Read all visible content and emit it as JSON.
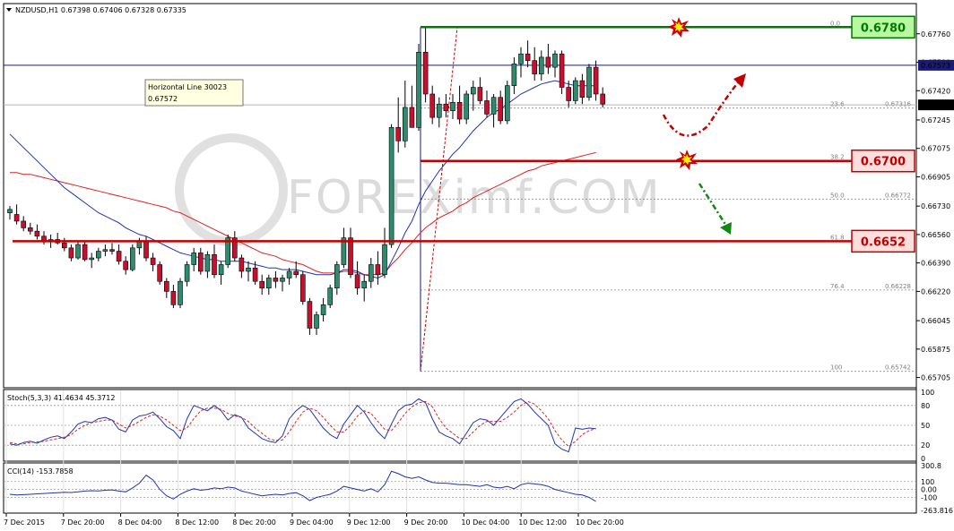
{
  "chart_data": {
    "type": "candlestick",
    "symbol_header": "NZDUSD,H1  0.67398 0.67406 0.67328 0.67335",
    "ylim": [
      0.6566,
      0.6793
    ],
    "y_ticks": [
      "0.67760",
      "0.67590",
      "0.67420",
      "0.67245",
      "0.67075",
      "0.66905",
      "0.66730",
      "0.66560",
      "0.66390",
      "0.66220",
      "0.66045",
      "0.65875",
      "0.65705"
    ],
    "x_ticks": [
      "7 Dec 2015",
      "7 Dec 20:00",
      "8 Dec 04:00",
      "8 Dec 12:00",
      "8 Dec 20:00",
      "9 Dec 04:00",
      "9 Dec 12:00",
      "9 Dec 20:00",
      "10 Dec 04:00",
      "10 Dec 12:00",
      "10 Dec 20:00"
    ],
    "current_price_label": "0.67335",
    "hline_price_label": "0.67573",
    "tooltip": {
      "title": "Horizontal Line 30023",
      "value": "0.67572"
    },
    "fib_levels": [
      {
        "ratio": "0.0",
        "price": 0.678,
        "value": ""
      },
      {
        "ratio": "23.6",
        "price": 0.67316,
        "value": "0.67316"
      },
      {
        "ratio": "38.2",
        "price": 0.67,
        "value": ""
      },
      {
        "ratio": "50.0",
        "price": 0.66772,
        "value": "0.66772"
      },
      {
        "ratio": "61.8",
        "price": 0.6652,
        "value": ""
      },
      {
        "ratio": "76.4",
        "price": 0.66228,
        "value": "0.66228"
      },
      {
        "ratio": "100",
        "price": 0.65742,
        "value": "0.65742"
      }
    ],
    "levels": [
      {
        "label": "0.6780",
        "price": 0.678,
        "color": "#007a00",
        "fill": "#b9f7a0"
      },
      {
        "label": "0.6700",
        "price": 0.67,
        "color": "#c00000",
        "fill": "#ffdede"
      },
      {
        "label": "0.6652",
        "price": 0.6652,
        "color": "#c00000",
        "fill": "#ffdede"
      }
    ],
    "candles": [
      [
        0.6669,
        0.6673,
        0.6665,
        0.6671
      ],
      [
        0.6668,
        0.6674,
        0.6662,
        0.6664
      ],
      [
        0.6664,
        0.6667,
        0.6658,
        0.666
      ],
      [
        0.666,
        0.6663,
        0.6656,
        0.6658
      ],
      [
        0.6658,
        0.6662,
        0.6653,
        0.6655
      ],
      [
        0.6655,
        0.6658,
        0.665,
        0.6652
      ],
      [
        0.6652,
        0.6656,
        0.6648,
        0.6653
      ],
      [
        0.6653,
        0.6657,
        0.665,
        0.6651
      ],
      [
        0.6651,
        0.6654,
        0.6646,
        0.6648
      ],
      [
        0.6648,
        0.665,
        0.664,
        0.6642
      ],
      [
        0.6642,
        0.6652,
        0.6641,
        0.665
      ],
      [
        0.665,
        0.6652,
        0.664,
        0.6641
      ],
      [
        0.6641,
        0.6645,
        0.6636,
        0.6642
      ],
      [
        0.6642,
        0.6648,
        0.664,
        0.6646
      ],
      [
        0.6646,
        0.665,
        0.6643,
        0.6647
      ],
      [
        0.6647,
        0.6651,
        0.6644,
        0.6646
      ],
      [
        0.6646,
        0.665,
        0.6638,
        0.664
      ],
      [
        0.664,
        0.6643,
        0.6632,
        0.6635
      ],
      [
        0.6635,
        0.665,
        0.6634,
        0.6648
      ],
      [
        0.6648,
        0.6654,
        0.6644,
        0.6652
      ],
      [
        0.6652,
        0.6655,
        0.664,
        0.6642
      ],
      [
        0.6642,
        0.6645,
        0.6634,
        0.6638
      ],
      [
        0.6638,
        0.664,
        0.6626,
        0.6628
      ],
      [
        0.6628,
        0.663,
        0.6618,
        0.6622
      ],
      [
        0.6622,
        0.6626,
        0.6612,
        0.6614
      ],
      [
        0.6614,
        0.663,
        0.6612,
        0.6628
      ],
      [
        0.6628,
        0.664,
        0.6625,
        0.6638
      ],
      [
        0.6638,
        0.6648,
        0.6634,
        0.6645
      ],
      [
        0.6645,
        0.6648,
        0.6632,
        0.6634
      ],
      [
        0.6634,
        0.6646,
        0.663,
        0.6644
      ],
      [
        0.6644,
        0.665,
        0.663,
        0.6632
      ],
      [
        0.6632,
        0.664,
        0.6626,
        0.6638
      ],
      [
        0.6638,
        0.6656,
        0.6636,
        0.6654
      ],
      [
        0.6654,
        0.6658,
        0.664,
        0.6642
      ],
      [
        0.6642,
        0.6644,
        0.663,
        0.6634
      ],
      [
        0.6634,
        0.664,
        0.6628,
        0.6636
      ],
      [
        0.6636,
        0.664,
        0.6626,
        0.6628
      ],
      [
        0.6628,
        0.6632,
        0.662,
        0.6624
      ],
      [
        0.6624,
        0.6632,
        0.662,
        0.663
      ],
      [
        0.663,
        0.6634,
        0.6624,
        0.6628
      ],
      [
        0.6628,
        0.6632,
        0.6622,
        0.663
      ],
      [
        0.663,
        0.6636,
        0.6626,
        0.6634
      ],
      [
        0.6634,
        0.664,
        0.663,
        0.6632
      ],
      [
        0.6632,
        0.6634,
        0.6614,
        0.6616
      ],
      [
        0.6616,
        0.6618,
        0.6596,
        0.66
      ],
      [
        0.66,
        0.661,
        0.6596,
        0.6608
      ],
      [
        0.6608,
        0.6618,
        0.6604,
        0.6614
      ],
      [
        0.6614,
        0.6626,
        0.6612,
        0.6624
      ],
      [
        0.6624,
        0.664,
        0.662,
        0.6638
      ],
      [
        0.6638,
        0.666,
        0.6636,
        0.6654
      ],
      [
        0.6654,
        0.666,
        0.663,
        0.6632
      ],
      [
        0.6632,
        0.664,
        0.662,
        0.6624
      ],
      [
        0.6624,
        0.6632,
        0.6616,
        0.6628
      ],
      [
        0.6628,
        0.6642,
        0.6624,
        0.6638
      ],
      [
        0.6638,
        0.6646,
        0.6626,
        0.6632
      ],
      [
        0.6632,
        0.666,
        0.663,
        0.665
      ],
      [
        0.665,
        0.6722,
        0.6648,
        0.672
      ],
      [
        0.672,
        0.6738,
        0.6705,
        0.6712
      ],
      [
        0.6712,
        0.6748,
        0.6708,
        0.6732
      ],
      [
        0.6732,
        0.6745,
        0.672,
        0.672
      ],
      [
        0.672,
        0.677,
        0.6718,
        0.6765
      ],
      [
        0.6765,
        0.678,
        0.6735,
        0.674
      ],
      [
        0.674,
        0.6745,
        0.6722,
        0.6726
      ],
      [
        0.6726,
        0.6738,
        0.672,
        0.6734
      ],
      [
        0.6734,
        0.674,
        0.6726,
        0.673
      ],
      [
        0.673,
        0.674,
        0.6725,
        0.6735
      ],
      [
        0.6735,
        0.6745,
        0.6722,
        0.6725
      ],
      [
        0.6725,
        0.6742,
        0.6722,
        0.674
      ],
      [
        0.674,
        0.6748,
        0.673,
        0.6744
      ],
      [
        0.6744,
        0.675,
        0.6734,
        0.6736
      ],
      [
        0.6736,
        0.6742,
        0.6726,
        0.6728
      ],
      [
        0.6728,
        0.674,
        0.672,
        0.6738
      ],
      [
        0.6738,
        0.6742,
        0.6722,
        0.6724
      ],
      [
        0.6724,
        0.6748,
        0.6722,
        0.6745
      ],
      [
        0.6745,
        0.6762,
        0.674,
        0.6758
      ],
      [
        0.6758,
        0.6768,
        0.675,
        0.6764
      ],
      [
        0.6764,
        0.6772,
        0.6756,
        0.676
      ],
      [
        0.676,
        0.6768,
        0.6748,
        0.6752
      ],
      [
        0.6752,
        0.6766,
        0.6748,
        0.6762
      ],
      [
        0.6762,
        0.677,
        0.6752,
        0.6756
      ],
      [
        0.6756,
        0.6766,
        0.675,
        0.6764
      ],
      [
        0.6764,
        0.6766,
        0.674,
        0.6744
      ],
      [
        0.6744,
        0.6748,
        0.6732,
        0.6736
      ],
      [
        0.6736,
        0.675,
        0.6734,
        0.6748
      ],
      [
        0.6748,
        0.6752,
        0.6734,
        0.6738
      ],
      [
        0.6738,
        0.6758,
        0.6736,
        0.6756
      ],
      [
        0.6756,
        0.676,
        0.6736,
        0.674
      ],
      [
        0.674,
        0.6744,
        0.6732,
        0.6734
      ]
    ],
    "ma_blue": [
      0.6716,
      0.6712,
      0.6708,
      0.6704,
      0.67,
      0.6696,
      0.6692,
      0.6688,
      0.6684,
      0.6681,
      0.6678,
      0.6675,
      0.6672,
      0.6669,
      0.6667,
      0.6665,
      0.6663,
      0.666,
      0.6658,
      0.6656,
      0.6655,
      0.6653,
      0.6651,
      0.6649,
      0.6647,
      0.6645,
      0.6644,
      0.6643,
      0.6642,
      0.6641,
      0.6641,
      0.664,
      0.664,
      0.664,
      0.664,
      0.6639,
      0.6638,
      0.6637,
      0.6636,
      0.6636,
      0.6635,
      0.6635,
      0.6635,
      0.6634,
      0.6633,
      0.6632,
      0.6632,
      0.6632,
      0.6633,
      0.6635,
      0.6635,
      0.6634,
      0.6632,
      0.6631,
      0.663,
      0.6632,
      0.664,
      0.6648,
      0.6657,
      0.6664,
      0.6674,
      0.6682,
      0.6688,
      0.6694,
      0.6699,
      0.6704,
      0.6708,
      0.6713,
      0.6718,
      0.6722,
      0.6726,
      0.6729,
      0.6731,
      0.6734,
      0.6737,
      0.674,
      0.6742,
      0.6744,
      0.6746,
      0.6747,
      0.6748,
      0.6747,
      0.6746,
      0.6745,
      0.6745,
      0.6745,
      0.6745
    ],
    "ma_red": [
      0.6693,
      0.6693,
      0.6692,
      0.6692,
      0.6691,
      0.669,
      0.6689,
      0.6688,
      0.6687,
      0.6686,
      0.6685,
      0.6684,
      0.6683,
      0.6682,
      0.6681,
      0.668,
      0.6679,
      0.6678,
      0.6677,
      0.6676,
      0.6675,
      0.6674,
      0.6673,
      0.6672,
      0.667,
      0.6669,
      0.6667,
      0.6665,
      0.6663,
      0.6661,
      0.6659,
      0.6657,
      0.6655,
      0.6653,
      0.6651,
      0.6649,
      0.6647,
      0.6645,
      0.6644,
      0.6643,
      0.6641,
      0.664,
      0.6639,
      0.6638,
      0.6636,
      0.6634,
      0.6633,
      0.6633,
      0.6633,
      0.6634,
      0.6634,
      0.6633,
      0.6632,
      0.6632,
      0.6632,
      0.6633,
      0.6638,
      0.6642,
      0.6647,
      0.6651,
      0.6656,
      0.666,
      0.6663,
      0.6666,
      0.6668,
      0.667,
      0.6673,
      0.6675,
      0.6678,
      0.668,
      0.6682,
      0.6684,
      0.6686,
      0.6688,
      0.669,
      0.6692,
      0.6694,
      0.6695,
      0.6697,
      0.6698,
      0.6699,
      0.67,
      0.6701,
      0.6702,
      0.6703,
      0.6704,
      0.6705
    ],
    "stoch": {
      "label": "Stoch(5,3,3) 41.4634 45.3712",
      "ticks": [
        "100",
        "80",
        "50",
        "20",
        "0"
      ],
      "main": [
        22,
        20,
        24,
        26,
        23,
        28,
        32,
        34,
        30,
        40,
        52,
        56,
        54,
        60,
        62,
        58,
        44,
        40,
        58,
        64,
        66,
        70,
        60,
        48,
        42,
        30,
        60,
        80,
        76,
        72,
        80,
        72,
        58,
        66,
        62,
        46,
        38,
        30,
        26,
        24,
        34,
        60,
        72,
        80,
        74,
        60,
        46,
        36,
        30,
        52,
        66,
        80,
        70,
        54,
        40,
        30,
        52,
        72,
        80,
        82,
        90,
        84,
        60,
        40,
        34,
        30,
        22,
        38,
        54,
        60,
        58,
        50,
        62,
        74,
        86,
        90,
        82,
        70,
        60,
        50,
        22,
        14,
        10,
        46,
        44,
        46,
        45
      ],
      "signal": [
        24,
        22,
        22,
        24,
        25,
        26,
        28,
        30,
        32,
        36,
        44,
        50,
        54,
        56,
        58,
        58,
        52,
        46,
        50,
        56,
        62,
        66,
        64,
        58,
        50,
        42,
        46,
        60,
        72,
        76,
        76,
        74,
        68,
        64,
        62,
        56,
        46,
        38,
        30,
        27,
        28,
        40,
        56,
        70,
        76,
        72,
        62,
        50,
        40,
        40,
        50,
        64,
        72,
        68,
        56,
        44,
        42,
        54,
        68,
        78,
        84,
        86,
        78,
        60,
        46,
        38,
        30,
        30,
        40,
        50,
        56,
        56,
        56,
        62,
        70,
        80,
        86,
        82,
        72,
        60,
        42,
        28,
        18,
        26,
        36,
        42,
        45
      ]
    },
    "cci": {
      "label": "CCI(14) -153.7858",
      "ticks": [
        "300.8",
        "100",
        "0.00",
        "-100",
        "-263.816"
      ],
      "values": [
        -60,
        -70,
        -65,
        -60,
        -55,
        -50,
        -45,
        -40,
        -35,
        -38,
        -30,
        -20,
        -15,
        -18,
        -10,
        -5,
        -20,
        -30,
        20,
        80,
        180,
        120,
        0,
        -80,
        -120,
        -60,
        -20,
        10,
        -10,
        0,
        20,
        10,
        30,
        20,
        -20,
        -40,
        -60,
        -80,
        -70,
        -60,
        -70,
        -50,
        -40,
        -80,
        -140,
        -100,
        -80,
        -60,
        -20,
        40,
        20,
        0,
        -20,
        10,
        -30,
        60,
        230,
        200,
        160,
        140,
        160,
        120,
        90,
        80,
        80,
        70,
        60,
        60,
        50,
        40,
        60,
        30,
        20,
        40,
        10,
        60,
        80,
        70,
        60,
        40,
        0,
        -20,
        -40,
        -60,
        -70,
        -100,
        -150
      ]
    }
  }
}
